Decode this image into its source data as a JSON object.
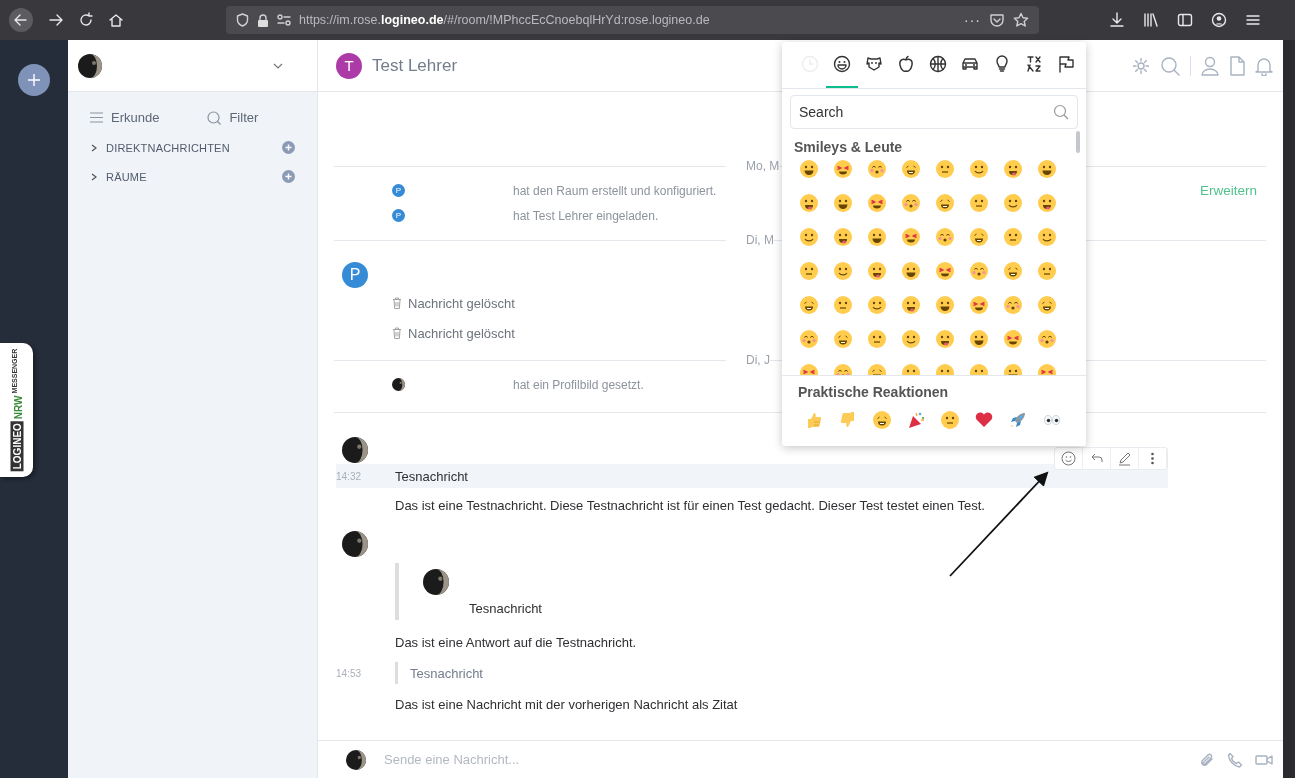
{
  "browser": {
    "url": "https://im.rose.**logineo.de**/#/room/!MPhccEcCnoebqlHrYd:rose.logineo.de",
    "overflow_menu": "···"
  },
  "rail": {
    "badge": {
      "brand": "LOGINEO",
      "region": "NRW",
      "product": "MESSENGER"
    }
  },
  "sidebar": {
    "explore": "Erkunde",
    "filter": "Filter",
    "sections": [
      {
        "label": "DIREKTNACHRICHTEN",
        "expanded": false
      },
      {
        "label": "RÄUME",
        "expanded": false
      }
    ]
  },
  "room": {
    "avatar_letter": "T",
    "title": "Test Lehrer"
  },
  "timeline": [
    {
      "kind": "divider",
      "label": "Mo, M"
    },
    {
      "kind": "event",
      "avatar_letter": "P",
      "text": "hat den Raum erstellt und konfiguriert.",
      "action": "Erweitern"
    },
    {
      "kind": "event",
      "avatar_letter": "P",
      "text": "hat Test Lehrer eingeladen."
    },
    {
      "kind": "divider",
      "label": "Di, M"
    },
    {
      "kind": "sender",
      "avatar_letter": "P"
    },
    {
      "kind": "deleted",
      "text": "Nachricht gelöscht"
    },
    {
      "kind": "deleted",
      "text": "Nachricht gelöscht"
    },
    {
      "kind": "divider",
      "label": "Di, J"
    },
    {
      "kind": "event",
      "text": "hat ein Profilbild gesetzt."
    },
    {
      "kind": "divider"
    },
    {
      "kind": "sender"
    },
    {
      "kind": "message",
      "time": "14:32",
      "text": "Tesnachricht",
      "hovered": true
    },
    {
      "kind": "message",
      "text": "Das ist eine Testnachricht. Diese Testnachricht ist für einen Test gedacht. Dieser Test testet einen Test.",
      "hovered": false
    },
    {
      "kind": "sender"
    },
    {
      "kind": "reply",
      "text": "Tesnachricht"
    },
    {
      "kind": "message",
      "text": "Das ist eine Antwort auf die Testnachricht.",
      "hovered": false
    },
    {
      "kind": "quote",
      "time": "14:53",
      "text": "Tesnachricht"
    },
    {
      "kind": "message",
      "text": "Das ist eine Nachricht mit der vorherigen Nachricht als Zitat",
      "hovered": false
    }
  ],
  "composer": {
    "placeholder": "Sende eine Nachricht..."
  },
  "emoji_picker": {
    "tabs": [
      {
        "selected": false,
        "disabled": true
      },
      {
        "selected": true,
        "disabled": false
      },
      {
        "selected": false,
        "disabled": false
      },
      {
        "selected": false,
        "disabled": false
      },
      {
        "selected": false,
        "disabled": false
      },
      {
        "selected": false,
        "disabled": false
      },
      {
        "selected": false,
        "disabled": false
      },
      {
        "selected": false,
        "disabled": false
      },
      {
        "selected": false,
        "disabled": false
      }
    ],
    "search_placeholder": "Search",
    "section_title": "Smileys & Leute",
    "quick_title": "Praktische Reaktionen"
  }
}
